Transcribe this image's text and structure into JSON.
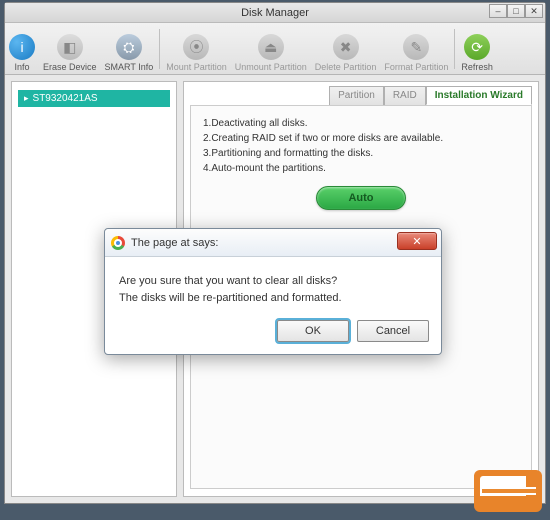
{
  "window": {
    "title": "Disk Manager"
  },
  "toolbar": {
    "info": "Info",
    "erase": "Erase Device",
    "smart": "SMART Info",
    "mount": "Mount Partition",
    "unmount": "Unmount Partition",
    "delete": "Delete Partition",
    "format": "Format Partition",
    "refresh": "Refresh"
  },
  "sidebar": {
    "disk0": "ST9320421AS"
  },
  "tabs": {
    "partition": "Partition",
    "raid": "RAID",
    "wizard": "Installation Wizard"
  },
  "wizard": {
    "step1": "1.Deactivating all disks.",
    "step2": "2.Creating RAID set if two or more disks are available.",
    "step3": "3.Partitioning and formatting the disks.",
    "step4": "4.Auto-mount the partitions.",
    "auto_btn": "Auto"
  },
  "dialog": {
    "title_prefix": "The page at",
    "title_host": " ",
    "title_suffix": "says:",
    "line1": "Are you sure that you want to clear all disks?",
    "line2": "The disks will be re-partitioned and formatted.",
    "ok": "OK",
    "cancel": "Cancel",
    "close_glyph": "✕"
  },
  "win_controls": {
    "min": "–",
    "max": "□",
    "close": "✕"
  }
}
